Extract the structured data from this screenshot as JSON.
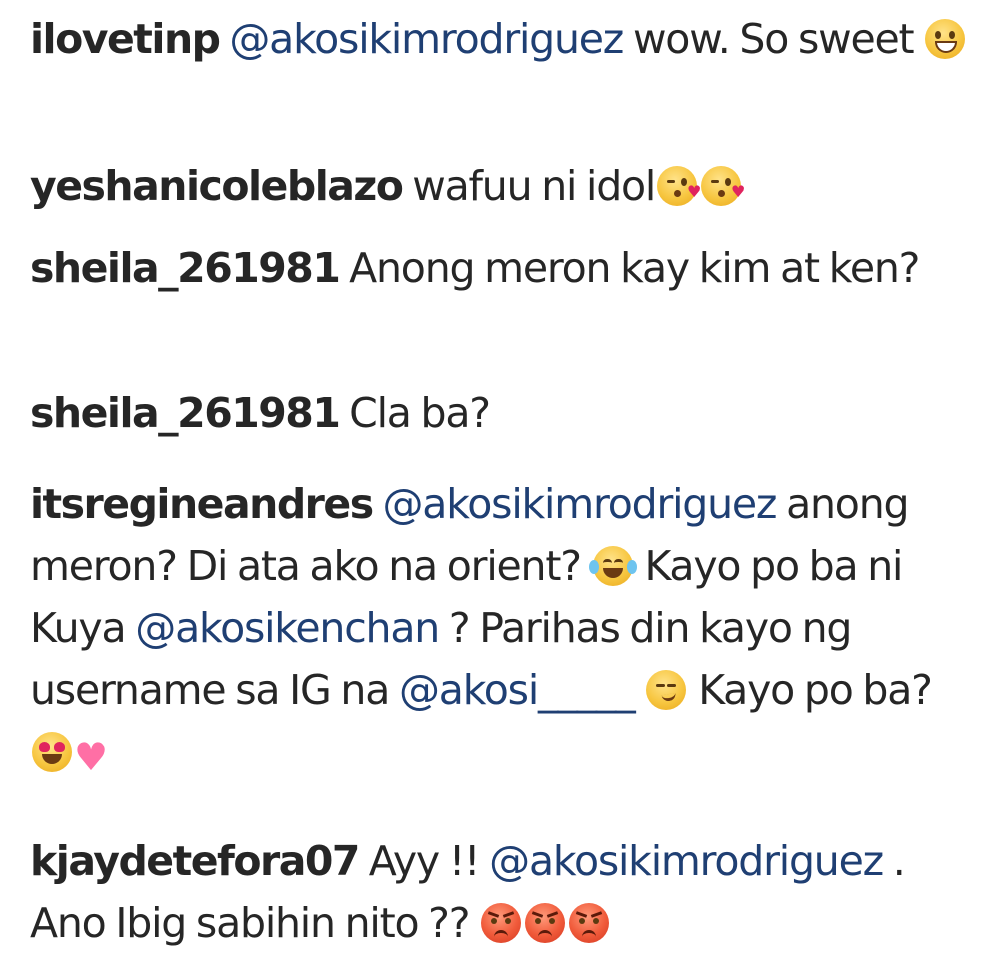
{
  "comments": [
    {
      "username": "ilovetinp",
      "parts": [
        {
          "type": "mention",
          "text": "@akosikimrodriguez"
        },
        {
          "type": "text",
          "text": " wow. So sweet "
        }
      ],
      "emojis": [
        "grinning-face"
      ]
    },
    {
      "username": "yeshanicoleblazo",
      "parts": [
        {
          "type": "text",
          "text": " wafuu ni idol"
        }
      ],
      "emojis": [
        "face-blowing-kiss",
        "face-blowing-kiss"
      ]
    },
    {
      "username": "sheila_261981",
      "parts": [
        {
          "type": "text",
          "text": " Anong meron kay kim at ken?"
        }
      ],
      "emojis": []
    },
    {
      "username": "sheila_261981",
      "parts": [
        {
          "type": "text",
          "text": " Cla ba?"
        }
      ],
      "emojis": []
    },
    {
      "username": "itsregineandres",
      "parts": [
        {
          "type": "mention",
          "text": "@akosikimrodriguez"
        },
        {
          "type": "text",
          "text": " anong meron? Di ata ako na orient? "
        },
        {
          "type": "text",
          "text": " Kayo po ba ni Kuya "
        },
        {
          "type": "mention",
          "text": "@akosikenchan"
        },
        {
          "type": "text",
          "text": " ? Parihas din kayo ng username sa IG na "
        },
        {
          "type": "mention",
          "text": "@akosi_____"
        },
        {
          "type": "text",
          "text": " Kayo po ba? "
        }
      ],
      "emojis": [
        "face-with-tears-of-joy",
        "smirking-face",
        "smiling-face-with-heart-eyes",
        "growing-heart"
      ]
    },
    {
      "username": "kjaydetefora07",
      "parts": [
        {
          "type": "text",
          "text": " Ayy !! "
        },
        {
          "type": "mention",
          "text": "@akosikimrodriguez"
        },
        {
          "type": "text",
          "text": " . Ano Ibig sabihin nito ?? "
        }
      ],
      "emojis": [
        "pouting-face",
        "pouting-face",
        "pouting-face"
      ]
    }
  ],
  "colors": {
    "text": "#262626",
    "mention": "#1f3f73",
    "background": "#ffffff"
  }
}
